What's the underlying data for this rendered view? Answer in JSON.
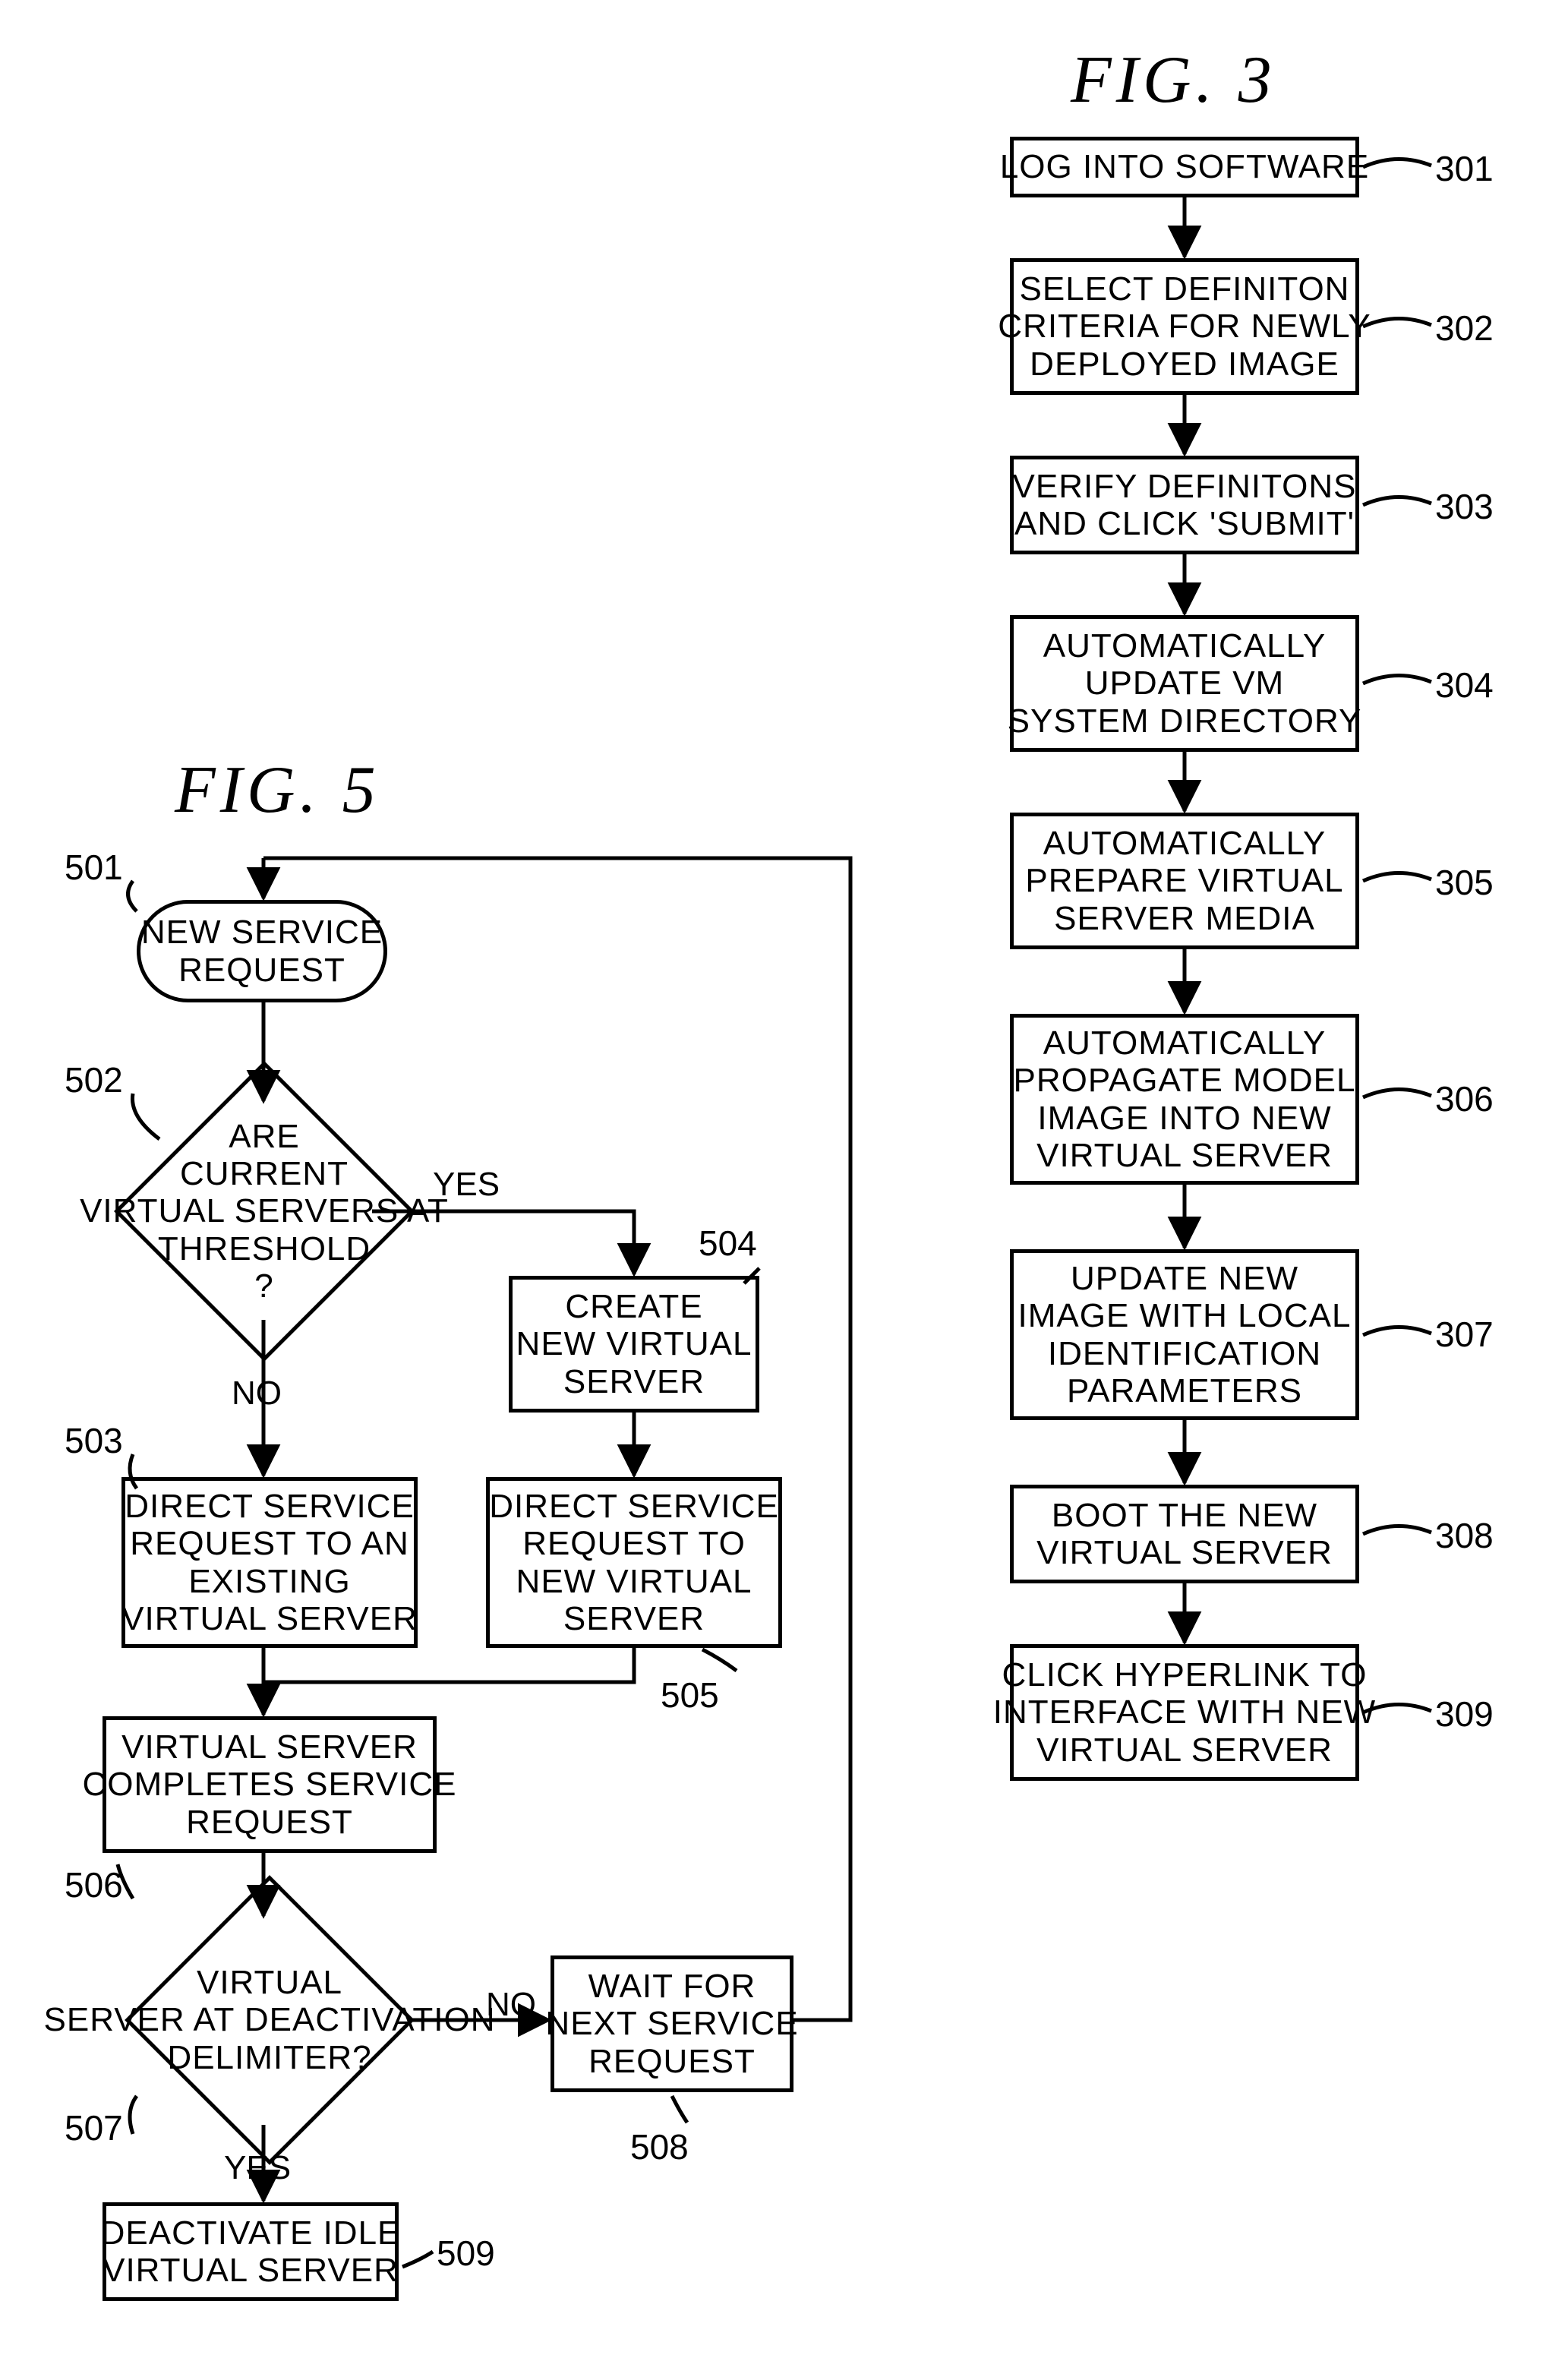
{
  "fig3": {
    "title": "FIG.  3",
    "steps": {
      "s301": "LOG INTO SOFTWARE",
      "s302": "SELECT DEFINITON\nCRITERIA FOR NEWLY\nDEPLOYED IMAGE",
      "s303": "VERIFY DEFINITONS\nAND CLICK 'SUBMIT'",
      "s304": "AUTOMATICALLY\nUPDATE VM\nSYSTEM DIRECTORY",
      "s305": "AUTOMATICALLY\nPREPARE VIRTUAL\nSERVER MEDIA",
      "s306": "AUTOMATICALLY\nPROPAGATE MODEL\nIMAGE INTO NEW\nVIRTUAL SERVER",
      "s307": "UPDATE NEW\nIMAGE WITH LOCAL\nIDENTIFICATION\nPARAMETERS",
      "s308": "BOOT THE NEW\nVIRTUAL SERVER",
      "s309": "CLICK HYPERLINK TO\nINTERFACE WITH NEW\nVIRTUAL SERVER"
    },
    "refs": {
      "r301": "301",
      "r302": "302",
      "r303": "303",
      "r304": "304",
      "r305": "305",
      "r306": "306",
      "r307": "307",
      "r308": "308",
      "r309": "309"
    }
  },
  "fig5": {
    "title": "FIG.  5",
    "nodes": {
      "n501": "NEW SERVICE\nREQUEST",
      "n502": "ARE\nCURRENT\nVIRTUAL SERVERS AT\nTHRESHOLD\n?",
      "n503": "DIRECT SERVICE\nREQUEST TO AN\nEXISTING\nVIRTUAL SERVER",
      "n504": "CREATE\nNEW VIRTUAL\nSERVER",
      "n505": "DIRECT SERVICE\nREQUEST TO\nNEW VIRTUAL\nSERVER",
      "n506": "VIRTUAL SERVER\nCOMPLETES SERVICE\nREQUEST",
      "n507": "VIRTUAL\nSERVER AT DEACTIVATION\nDELIMITER?",
      "n508": "WAIT FOR\nNEXT SERVICE\nREQUEST",
      "n509": "DEACTIVATE IDLE\nVIRTUAL SERVER"
    },
    "labels": {
      "yes502": "YES",
      "no502": "NO",
      "yes507": "YES",
      "no507": "NO"
    },
    "refs": {
      "r501": "501",
      "r502": "502",
      "r503": "503",
      "r504": "504",
      "r505": "505",
      "r506": "506",
      "r507": "507",
      "r508": "508",
      "r509": "509"
    }
  }
}
